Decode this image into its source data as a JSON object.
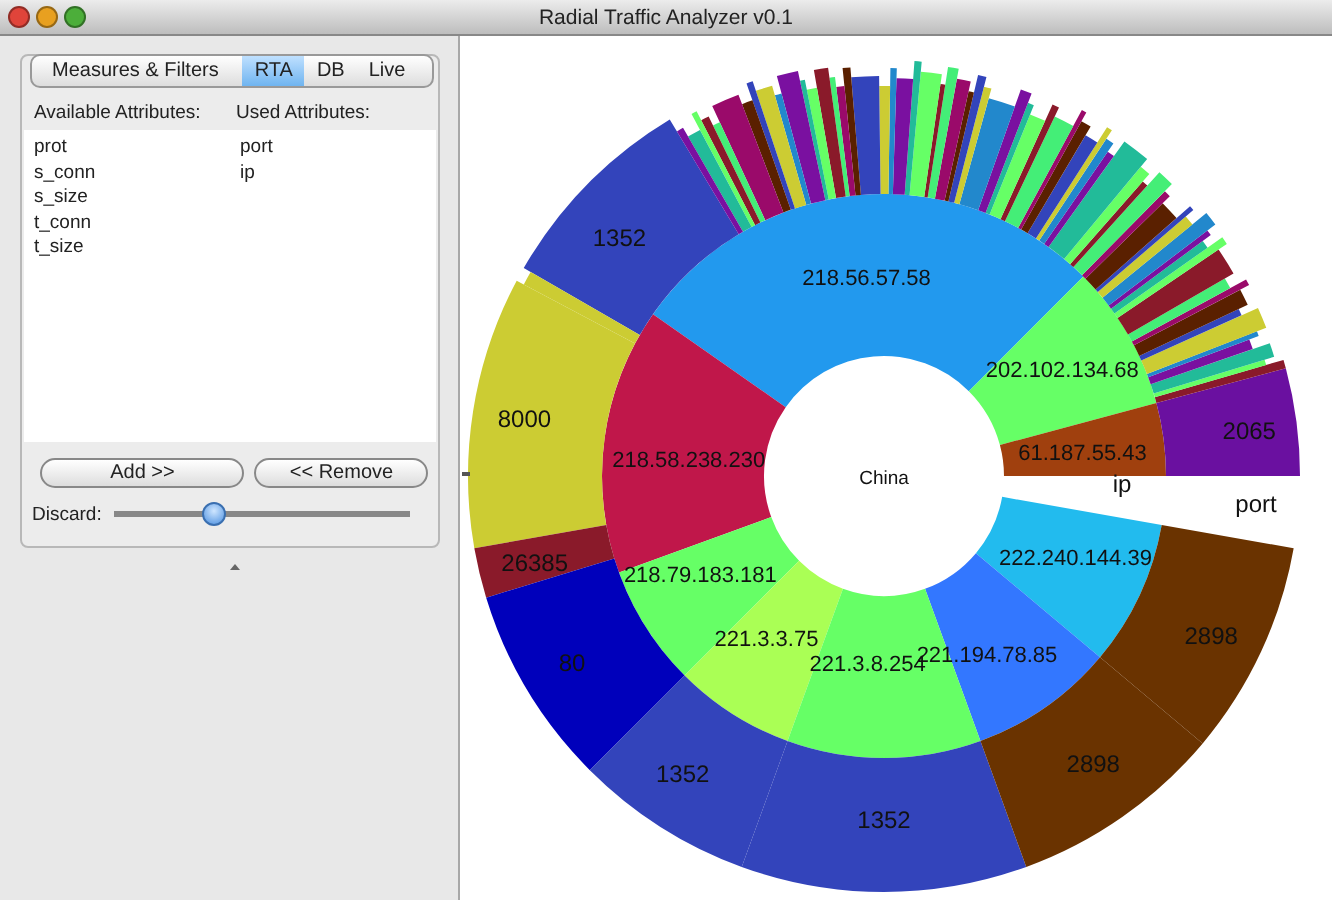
{
  "window": {
    "title": "Radial Traffic Analyzer v0.1"
  },
  "tabs": [
    {
      "label": "Measures & Filters",
      "selected": false
    },
    {
      "label": "RTA",
      "selected": true
    },
    {
      "label": "DB",
      "selected": false
    },
    {
      "label": "Live",
      "selected": false
    }
  ],
  "available": {
    "header": "Available Attributes:",
    "items": [
      "prot",
      "s_conn",
      "s_size",
      "t_conn",
      "t_size"
    ]
  },
  "used": {
    "header": "Used Attributes:",
    "items": [
      "port",
      "ip"
    ]
  },
  "buttons": [
    "Add >>",
    "<< Remove"
  ],
  "discard": {
    "label": "Discard:",
    "level": 0.34
  },
  "chart": {
    "center": "China",
    "levels": [
      "ip",
      "port"
    ],
    "inner": [
      {
        "label": "218.56.57.58",
        "color": "#2299ee"
      },
      {
        "label": "202.102.134.68",
        "color": "#66ff66"
      },
      {
        "label": "61.187.55.43",
        "color": "#a0400e"
      },
      {
        "label": "218.58.238.230",
        "color": "#c0174a"
      },
      {
        "label": "222.240.144.39",
        "color": "#22bbee"
      },
      {
        "label": "218.79.183.181",
        "color": "#66ff66"
      },
      {
        "label": "221.3.3.75",
        "color": "#aaff55"
      },
      {
        "label": "221.194.78.85",
        "color": "#3377ff"
      },
      {
        "label": "221.3.8.254",
        "color": "#66ff66"
      }
    ],
    "outer": [
      {
        "label": "2065",
        "color": "#6a10a0"
      },
      {
        "label": "1352",
        "color": "#3344bb"
      },
      {
        "label": "8000",
        "color": "#cccc33"
      },
      {
        "label": "26385",
        "color": "#8a1a2a"
      },
      {
        "label": "80",
        "color": "#0000bb"
      },
      {
        "label": "1352",
        "color": "#3344bb"
      },
      {
        "label": "1352",
        "color": "#3344bb"
      },
      {
        "label": "2898",
        "color": "#6a3300"
      },
      {
        "label": "2898",
        "color": "#6a3300"
      }
    ]
  }
}
